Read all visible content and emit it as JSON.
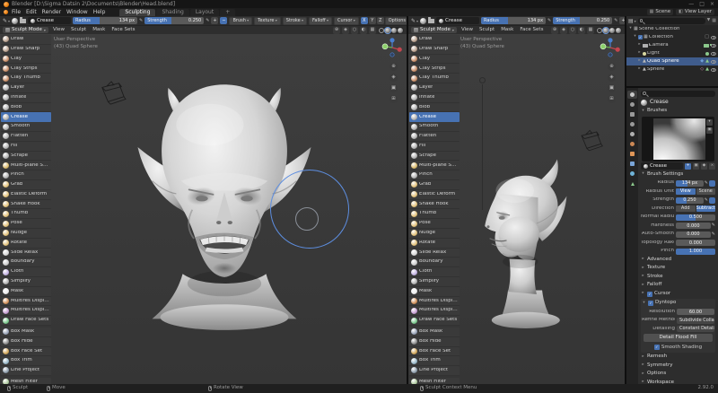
{
  "window": {
    "title": "Blender  [D:\\Sigma Datsin 2\\Documents\\Blender\\Head.blend]"
  },
  "menubar": {
    "menus": [
      "File",
      "Edit",
      "Render",
      "Window",
      "Help"
    ],
    "tabs": [
      {
        "label": "Sculpting",
        "active": true
      },
      {
        "label": "Shading",
        "active": false
      },
      {
        "label": "Layout",
        "active": false
      },
      {
        "label": "+",
        "active": false
      }
    ],
    "scene": "Scene",
    "view_layer": "View Layer"
  },
  "tool_settings": {
    "brush_name": "Crease",
    "radius_label": "Radius",
    "radius_value": "134 px",
    "radius_fill": 0.42,
    "strength_label": "Strength",
    "strength_value": "0.250",
    "strength_fill": 0.45,
    "direction_options": [
      "+",
      "−"
    ],
    "direction_active": 1,
    "dropdowns": [
      "Brush",
      "Texture",
      "Stroke",
      "Falloff",
      "Cursor"
    ],
    "mirror_axes": [
      "X",
      "Y",
      "Z"
    ],
    "mirror_active": "X",
    "options_label": "Options"
  },
  "viewport": {
    "mode": "Sculpt Mode",
    "menus": [
      "View",
      "Sculpt",
      "Mask",
      "Face Sets"
    ],
    "overlay_line1": "User Perspective",
    "overlay_line2": "(43) Quad Sphere"
  },
  "toolbar": [
    {
      "label": "Draw",
      "icon": "draw-brush-icon",
      "tint": "#b9a08d"
    },
    {
      "label": "Draw Sharp",
      "icon": "draw-sharp-brush-icon",
      "tint": "#b9a08d"
    },
    {
      "label": "Clay",
      "icon": "clay-brush-icon",
      "tint": "#c98d66"
    },
    {
      "label": "Clay Strips",
      "icon": "clay-strips-brush-icon",
      "tint": "#c98d66"
    },
    {
      "label": "Clay Thumb",
      "icon": "clay-thumb-brush-icon",
      "tint": "#c98d66"
    },
    {
      "label": "Layer",
      "icon": "layer-brush-icon",
      "tint": "#b3b3b3"
    },
    {
      "label": "Inflate",
      "icon": "inflate-brush-icon",
      "tint": "#b3b3b3"
    },
    {
      "label": "Blob",
      "icon": "blob-brush-icon",
      "tint": "#b3b3b3"
    },
    {
      "label": "Crease",
      "icon": "crease-brush-icon",
      "tint": "#b3b3b3",
      "selected": true
    },
    {
      "label": "Smooth",
      "icon": "smooth-brush-icon",
      "tint": "#b3b3b3"
    },
    {
      "label": "Flatten",
      "icon": "flatten-brush-icon",
      "tint": "#b3b3b3"
    },
    {
      "label": "Fill",
      "icon": "fill-brush-icon",
      "tint": "#b3b3b3"
    },
    {
      "label": "Scrape",
      "icon": "scrape-brush-icon",
      "tint": "#b3b3b3"
    },
    {
      "label": "Multi-plane Scrape",
      "icon": "multiplane-scrape-brush-icon",
      "tint": "#d9b96a"
    },
    {
      "label": "Pinch",
      "icon": "pinch-brush-icon",
      "tint": "#b3b3b3"
    },
    {
      "label": "Grab",
      "icon": "grab-brush-icon",
      "tint": "#e3c27a"
    },
    {
      "label": "Elastic Deform",
      "icon": "elastic-deform-brush-icon",
      "tint": "#e3c27a"
    },
    {
      "label": "Snake Hook",
      "icon": "snake-hook-brush-icon",
      "tint": "#e3c27a"
    },
    {
      "label": "Thumb",
      "icon": "thumb-brush-icon",
      "tint": "#e3c27a"
    },
    {
      "label": "Pose",
      "icon": "pose-brush-icon",
      "tint": "#e3c27a"
    },
    {
      "label": "Nudge",
      "icon": "nudge-brush-icon",
      "tint": "#e3c27a"
    },
    {
      "label": "Rotate",
      "icon": "rotate-brush-icon",
      "tint": "#e3c27a"
    },
    {
      "label": "Slide Relax",
      "icon": "slide-relax-brush-icon",
      "tint": "#d8d8d8"
    },
    {
      "label": "Boundary",
      "icon": "boundary-brush-icon",
      "tint": "#cccccc"
    },
    {
      "label": "Cloth",
      "icon": "cloth-brush-icon",
      "tint": "#c3b2e3"
    },
    {
      "label": "Simplify",
      "icon": "simplify-brush-icon",
      "tint": "#b3b3b3"
    },
    {
      "label": "Mask",
      "icon": "mask-brush-icon",
      "tint": "#ededed"
    },
    {
      "label": "Multires Displacement Eraser",
      "icon": "multires-displacement-eraser-icon",
      "tint": "#d39058"
    },
    {
      "label": "Multires Displacement Smear",
      "icon": "multires-displacement-smear-icon",
      "tint": "#c79ed3"
    },
    {
      "label": "Draw Face Sets",
      "icon": "draw-face-sets-icon",
      "tint": "#79c98c"
    },
    {
      "label": "Box Mask",
      "icon": "box-mask-icon",
      "tint": "#98a3b8",
      "sep": true
    },
    {
      "label": "Box Hide",
      "icon": "box-hide-icon",
      "tint": "#8c8c8c"
    },
    {
      "label": "Box Face Set",
      "icon": "box-face-set-icon",
      "tint": "#d3a758"
    },
    {
      "label": "Box Trim",
      "icon": "box-trim-icon",
      "tint": "#98b8c9"
    },
    {
      "label": "Line Project",
      "icon": "line-project-icon",
      "tint": "#8c9cab"
    },
    {
      "label": "Mesh Filter",
      "icon": "mesh-filter-icon",
      "tint": "#aeca9e",
      "sep": true
    }
  ],
  "outliner": {
    "search_placeholder": "",
    "rows": [
      {
        "label": "Scene Collection",
        "icon": "scene-collection-icon",
        "indent": 0,
        "caret": "▾"
      },
      {
        "label": "Collection",
        "icon": "collection-icon",
        "indent": 1,
        "caret": "▾",
        "checkbox": true,
        "right_icons": [
          "screen-icon",
          "eye-icon"
        ]
      },
      {
        "label": "Camera",
        "icon": "camera-object-icon",
        "indent": 2,
        "caret": "▸",
        "data_icons": [
          "camera-data-icon"
        ],
        "eye": true
      },
      {
        "label": "Light",
        "icon": "light-object-icon",
        "indent": 2,
        "caret": "▸",
        "data_icons": [
          "light-data-icon"
        ],
        "eye": true
      },
      {
        "label": "Quad Sphere",
        "icon": "mesh-object-icon",
        "indent": 2,
        "caret": "▸",
        "data_icons": [
          "modifier-icon",
          "mesh-data-icon"
        ],
        "eye": true,
        "selected": true
      },
      {
        "label": "Sphere",
        "icon": "mesh-object-icon",
        "indent": 2,
        "caret": "▸",
        "data_icons": [
          "shapekey-icon",
          "mesh-data-icon"
        ],
        "eye": true
      }
    ]
  },
  "properties": {
    "search_placeholder": "",
    "active_tool": "Crease",
    "brushes_panel": "Brushes",
    "brush_name": "Crease",
    "brush_settings_panel": "Brush Settings",
    "rows": [
      {
        "label": "Radius",
        "value": "134 px",
        "type": "slider",
        "fill": 0.42,
        "pen": true,
        "toggle": true
      },
      {
        "label": "Radius Unit",
        "type": "segment",
        "options": [
          "View",
          "Scene"
        ],
        "active": 0
      },
      {
        "label": "Strength",
        "value": "0.250",
        "type": "slider",
        "fill": 0.4,
        "pen": true,
        "toggle": true
      },
      {
        "label": "Direction",
        "type": "segment",
        "options": [
          "Add",
          "Subtract"
        ],
        "active": 1
      },
      {
        "label": "Normal Radius",
        "value": "0.500",
        "type": "slider",
        "fill": 0.5
      },
      {
        "label": "Hardness",
        "value": "0.000",
        "type": "slider",
        "fill": 0,
        "pen": true
      },
      {
        "label": "Auto-Smooth",
        "value": "0.000",
        "type": "slider",
        "fill": 0,
        "pen": true
      },
      {
        "label": "Topology Rake",
        "value": "0.000",
        "type": "slider",
        "fill": 0
      },
      {
        "label": "Pinch",
        "value": "1.000",
        "type": "slider",
        "fill": 1
      }
    ],
    "collapsed_panels": [
      "Advanced",
      "Texture",
      "Stroke",
      "Falloff"
    ],
    "cursor_panel": "Cursor",
    "dyntopo": {
      "label": "Dyntopo",
      "resolution_label": "Resolution",
      "resolution_value": "60.00",
      "refine_label": "Refine Method",
      "refine_value": "Subdivide Collapse",
      "detail_label": "Detailing",
      "detail_value": "Constant Detail",
      "flood_button": "Detail Flood Fill",
      "smooth_label": "Smooth Shading"
    },
    "collapsed_panels_after": [
      "Remesh",
      "Symmetry",
      "Options",
      "Workspace"
    ],
    "tabs": [
      {
        "name": "tool-tab",
        "shape": "circle",
        "color": "#c8c8c8",
        "active": true
      },
      {
        "name": "render-tab",
        "shape": "circle",
        "color": "#9a9a9a"
      },
      {
        "name": "output-tab",
        "shape": "square",
        "color": "#9a9a9a"
      },
      {
        "name": "view-layer-tab",
        "shape": "circle",
        "color": "#9a9a9a"
      },
      {
        "name": "scene-tab",
        "shape": "circle",
        "color": "#b0b0b0"
      },
      {
        "name": "world-tab",
        "shape": "circle",
        "color": "#cc8855"
      },
      {
        "name": "object-tab",
        "shape": "square",
        "color": "#e09658"
      },
      {
        "name": "modifiers-tab",
        "shape": "square",
        "color": "#7aa5d8"
      },
      {
        "name": "physics-tab",
        "shape": "circle",
        "color": "#6fb3d8"
      },
      {
        "name": "object-data-tab",
        "shape": "tri",
        "color": "#8cc98c"
      }
    ]
  },
  "statusbar": {
    "hints": [
      "Sculpt",
      "Move",
      "Rotate View",
      "Sculpt Context Menu"
    ],
    "version": "2.92.0"
  }
}
